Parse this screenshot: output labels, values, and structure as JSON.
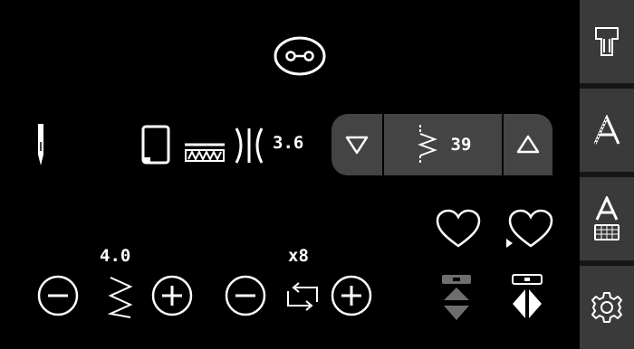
{
  "stitch": {
    "width_value": "3.6",
    "stitch_number": "39",
    "length_value": "4.0",
    "repeat_value": "x8"
  },
  "icons": {
    "top": "buttonhole-icon",
    "needle": "needle-icon",
    "presser_foot": "presser-foot-icon",
    "feed_dog": "feed-dog-icon",
    "stitch_width": "stitch-width-icon",
    "prev_stitch": "triangle-down-icon",
    "stitch_pattern": "zigzag-stitch-icon",
    "next_stitch": "triangle-up-icon",
    "favorite": "heart-icon",
    "favorite_add": "heart-add-icon",
    "length_decrease": "minus-circle-icon",
    "length": "stitch-length-icon",
    "length_increase": "plus-circle-icon",
    "repeat_decrease": "minus-circle-icon",
    "repeat": "repeat-icon",
    "repeat_increase": "plus-circle-icon",
    "mirror_vertical": "mirror-vertical-icon",
    "mirror_horizontal": "mirror-horizontal-icon",
    "side_stitch_menu": "stitch-menu-icon",
    "side_alphabet": "alphabet-icon",
    "side_alphabet_keyboard": "alphabet-keyboard-icon",
    "side_settings": "settings-gear-icon"
  },
  "colors": {
    "background": "#000000",
    "panel": "#444444",
    "sidebar_button": "#3a3a3a",
    "icon": "#ffffff",
    "disabled": "#6e6e6e"
  }
}
